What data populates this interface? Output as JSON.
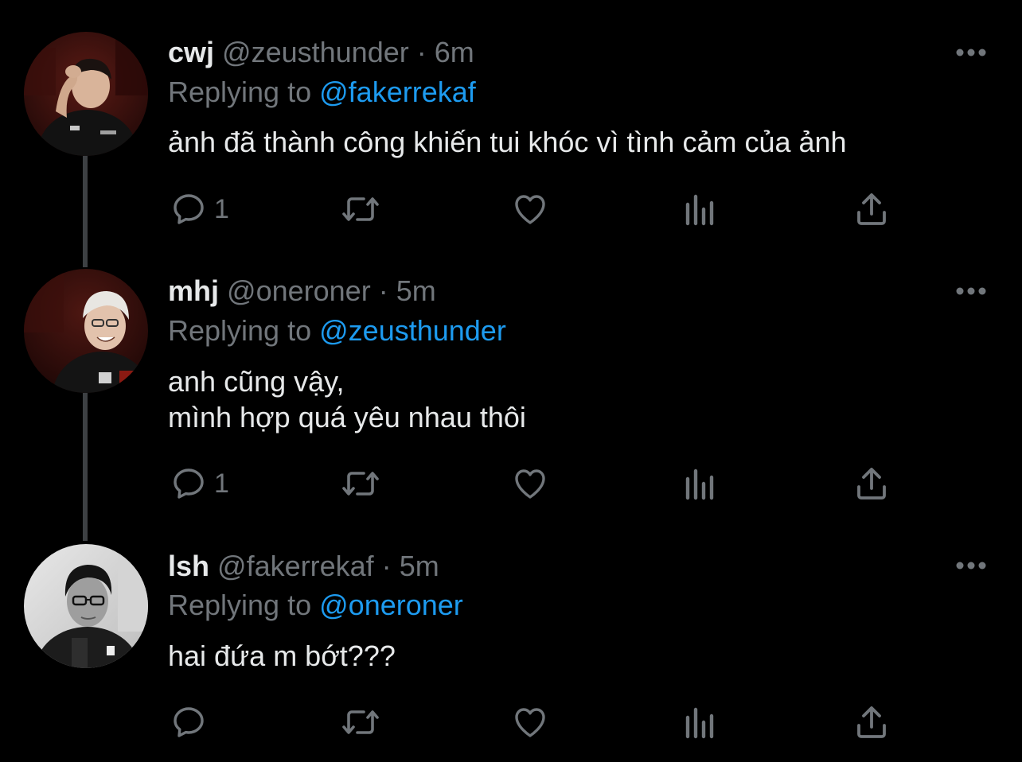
{
  "colors": {
    "background": "#000000",
    "text": "#e7e9ea",
    "muted": "#71767b",
    "accent": "#1d9bf0",
    "thread_line": "#3d4043"
  },
  "thread": [
    {
      "name": "cwj",
      "handle": "@zeusthunder",
      "separator": "·",
      "time": "6m",
      "replying_prefix": "Replying to",
      "replying_to": "@fakerrekaf",
      "lines": [
        "ảnh đã thành công khiến tui khóc vì tình cảm của ảnh"
      ],
      "reply_count": "1",
      "avatar_icon": "avatar-photo"
    },
    {
      "name": "mhj",
      "handle": "@oneroner",
      "separator": "·",
      "time": "5m",
      "replying_prefix": "Replying to",
      "replying_to": "@zeusthunder",
      "lines": [
        "anh cũng vậy,",
        "mình hợp quá yêu nhau thôi"
      ],
      "reply_count": "1",
      "avatar_icon": "avatar-photo"
    },
    {
      "name": "lsh",
      "handle": "@fakerrekaf",
      "separator": "·",
      "time": "5m",
      "replying_prefix": "Replying to",
      "replying_to": "@oneroner",
      "lines": [
        "hai đứa m bớt???"
      ],
      "reply_count": "",
      "avatar_icon": "avatar-photo"
    }
  ],
  "action_icons": [
    "reply-icon",
    "retweet-icon",
    "like-icon",
    "analytics-icon",
    "share-icon"
  ]
}
